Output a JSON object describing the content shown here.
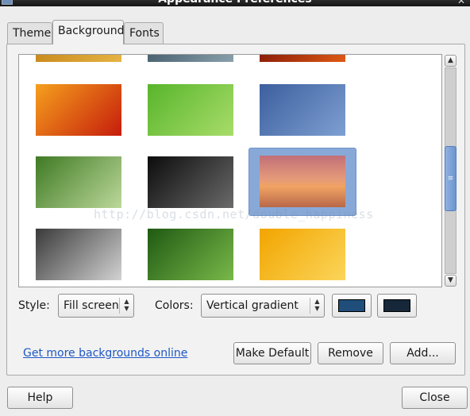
{
  "window": {
    "title": "Appearance Preferences"
  },
  "tabs": [
    {
      "label": "Theme",
      "active": false
    },
    {
      "label": "Background",
      "active": true
    },
    {
      "label": "Fonts",
      "active": false
    }
  ],
  "backgrounds": {
    "selected_index": 8,
    "thumbnails": [
      {
        "name": "top-row-1",
        "colors": [
          "#c98a1e",
          "#e6b444"
        ]
      },
      {
        "name": "top-row-2",
        "colors": [
          "#4a6270",
          "#8aa1ad"
        ]
      },
      {
        "name": "top-row-3",
        "colors": [
          "#8a1d07",
          "#e05a15"
        ]
      },
      {
        "name": "red-flower",
        "colors": [
          "#f5a01d",
          "#c61c0c"
        ]
      },
      {
        "name": "green-grass",
        "colors": [
          "#58b52b",
          "#a8dc6a"
        ]
      },
      {
        "name": "blue-abstract",
        "colors": [
          "#3c5f9e",
          "#7e9fd2"
        ]
      },
      {
        "name": "blue-flowers",
        "colors": [
          "#3f7a24",
          "#bcd89a"
        ]
      },
      {
        "name": "dark-wave",
        "colors": [
          "#0c0c0c",
          "#6a6a6a"
        ]
      },
      {
        "name": "sunset-lake",
        "colors": [
          "#c8716a",
          "#f2a36c"
        ]
      },
      {
        "name": "gray-sand",
        "colors": [
          "#3a3a3a",
          "#d2d2d2"
        ]
      },
      {
        "name": "green-leaves",
        "colors": [
          "#1f5a12",
          "#79b84a"
        ]
      },
      {
        "name": "orange-waves",
        "colors": [
          "#f2a500",
          "#fbd55a"
        ]
      }
    ]
  },
  "style": {
    "label": "Style:",
    "value": "Fill screen"
  },
  "colors": {
    "label": "Colors:",
    "value": "Vertical gradient",
    "primary": "#1f4e7a",
    "secondary": "#16273a"
  },
  "links": {
    "more_backgrounds": "Get more backgrounds online"
  },
  "buttons": {
    "make_default": "Make Default",
    "remove": "Remove",
    "add": "Add...",
    "help": "Help",
    "close": "Close"
  },
  "watermark": "http://blog.csdn.net/double_happiness"
}
